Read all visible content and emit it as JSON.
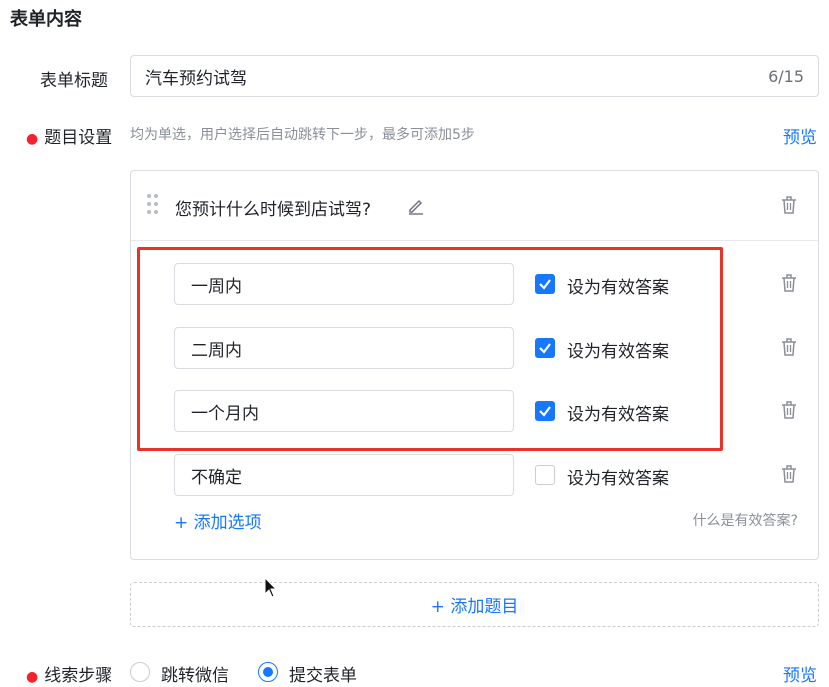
{
  "section_title": "表单内容",
  "form_title": {
    "label": "表单标题",
    "value": "汽车预约试驾",
    "count": "6/15"
  },
  "question_setting": {
    "label": "题目设置",
    "hint": "均为单选，用户选择后自动跳转下一步，最多可添加5步",
    "preview": "预览"
  },
  "question": {
    "text": "您预计什么时候到店试驾?",
    "options": [
      {
        "value": "一周内",
        "valid_label": "设为有效答案",
        "checked": true
      },
      {
        "value": "二周内",
        "valid_label": "设为有效答案",
        "checked": true
      },
      {
        "value": "一个月内",
        "valid_label": "设为有效答案",
        "checked": true
      },
      {
        "value": "不确定",
        "valid_label": "设为有效答案",
        "checked": false
      }
    ],
    "add_option": "+ 添加选项",
    "what_valid": "什么是有效答案?"
  },
  "add_question": "+ 添加题目",
  "clue_steps": {
    "label": "线索步骤",
    "options": [
      "跳转微信",
      "提交表单"
    ],
    "selected": "提交表单",
    "preview": "预览"
  },
  "colors": {
    "accent": "#1677ff",
    "highlight_box": "#e8332b",
    "required": "#f5222d"
  }
}
